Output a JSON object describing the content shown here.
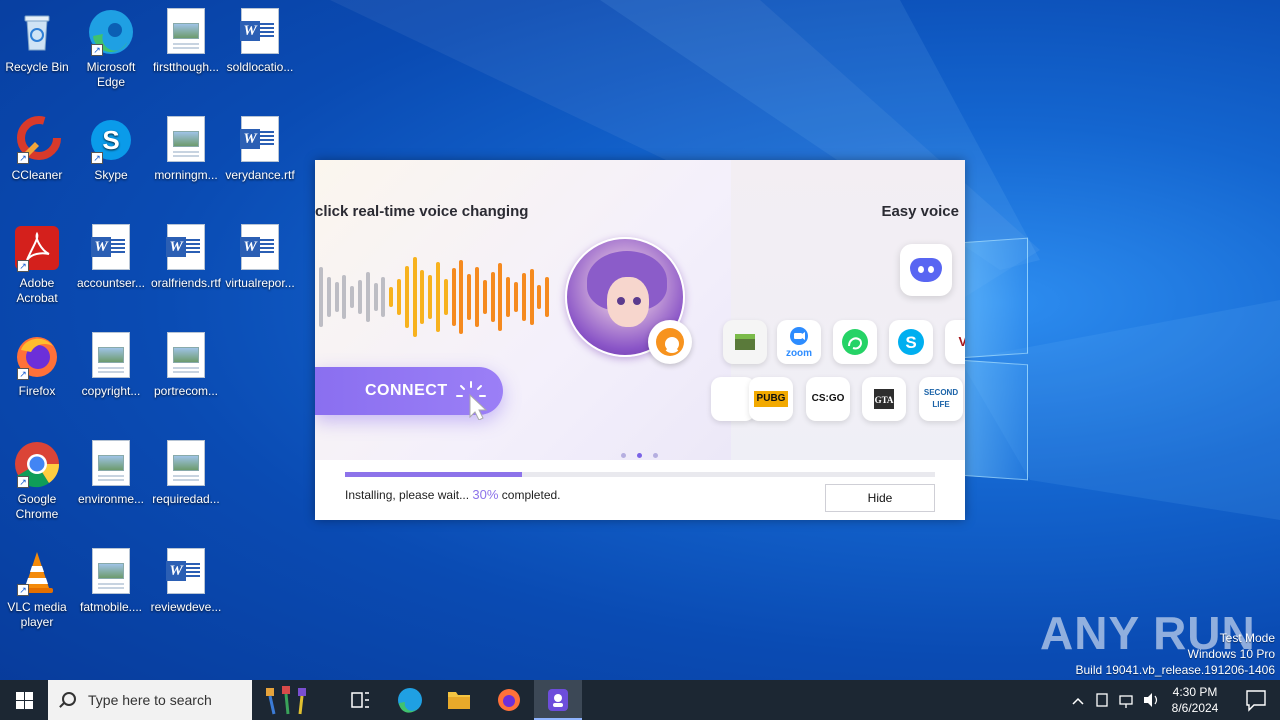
{
  "desktop": {
    "icons": [
      {
        "label": "Recycle Bin"
      },
      {
        "label": "Microsoft Edge"
      },
      {
        "label": "firstthough..."
      },
      {
        "label": "soldlocatio..."
      },
      {
        "label": "CCleaner"
      },
      {
        "label": "Skype"
      },
      {
        "label": "morningm..."
      },
      {
        "label": "verydance.rtf"
      },
      {
        "label": "Adobe Acrobat"
      },
      {
        "label": "accountser..."
      },
      {
        "label": "oralfriends.rtf"
      },
      {
        "label": "virtualrepor..."
      },
      {
        "label": "Firefox"
      },
      {
        "label": "copyright..."
      },
      {
        "label": "portrecom..."
      },
      {
        "label": "Google Chrome"
      },
      {
        "label": "environme..."
      },
      {
        "label": "requiredad..."
      },
      {
        "label": "VLC media player"
      },
      {
        "label": "fatmobile...."
      },
      {
        "label": "reviewdeve..."
      }
    ]
  },
  "installer": {
    "slide_left_headline": "click real-time voice changing",
    "slide_right_headline": "Easy voice",
    "connect_label": "CONNECT",
    "app_tiles": [
      "zoom",
      "PUBG",
      "CS:GO",
      "SECOND LIFE"
    ],
    "progress": {
      "fraction": 0.3,
      "status_prefix": "Installing, please wait...",
      "percent_text": "30%",
      "status_suffix": "completed."
    },
    "hide_label": "Hide",
    "accent_color": "#8d73ea"
  },
  "watermark": {
    "text": "ANY RUN",
    "line1": "Test Mode",
    "line2": "Windows 10 Pro",
    "line3": "Build 19041.vb_release.191206-1406"
  },
  "taskbar": {
    "search_placeholder": "Type here to search",
    "time": "4:30 PM",
    "date": "8/6/2024"
  }
}
